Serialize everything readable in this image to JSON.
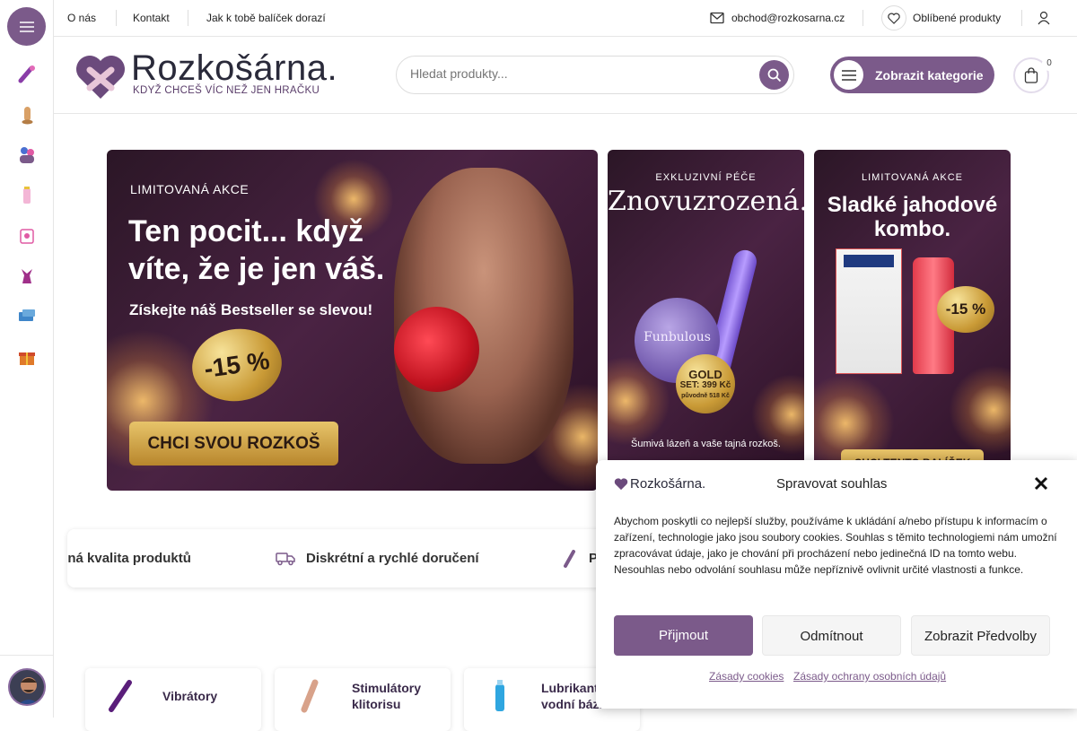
{
  "topbar": {
    "links": [
      "O nás",
      "Kontakt",
      "Jak k tobě balíček dorazí"
    ],
    "email": "obchod@rozkosarna.cz",
    "favorites": "Oblíbené produkty"
  },
  "header": {
    "brand": "Rozkošárna.",
    "tagline": "KDYŽ CHCEŠ VÍC NEŽ JEN HRAČKU",
    "search_placeholder": "Hledat produkty...",
    "categories_button": "Zobrazit kategorie",
    "cart_count": "0"
  },
  "sidebar": {
    "icons": [
      "vibrator-icon",
      "dildo-icon",
      "couples-icon",
      "lubricant-icon",
      "condom-icon",
      "lingerie-icon",
      "bdsm-icon",
      "gift-icon"
    ]
  },
  "banners": {
    "main": {
      "kicker": "LIMITOVANÁ AKCE",
      "headline": "Ten pocit... když víte, že je jen váš.",
      "subline": "Získejte náš Bestseller se slevou!",
      "badge": "-15 %",
      "cta": "CHCI SVOU ROZKOŠ"
    },
    "second": {
      "kicker": "EXKLUZIVNÍ PÉČE",
      "headline": "Znovuzrozená.",
      "product": "Funbulous",
      "badge_title": "GOLD",
      "badge_price": "SET: 399 Kč",
      "badge_note": "původně 518 Kč",
      "footer": "Šumivá lázeň a vaše tajná rozkoš."
    },
    "third": {
      "kicker": "LIMITOVANÁ AKCE",
      "headline": "Sladké jahodové kombo.",
      "badge": "-15 %",
      "cta": "CHCI TENTO BALÍČEK"
    }
  },
  "usp": [
    "ená kvalita produktů",
    "Diskrétní a rychlé doručení",
    "P"
  ],
  "categories": [
    "Vibrátory",
    "Stimulátory klitorisu",
    "Lubrikanty na vodní bázi"
  ],
  "cookie": {
    "brand": "Rozkošárna.",
    "title": "Spravovat souhlas",
    "body": "Abychom poskytli co nejlepší služby, používáme k ukládání a/nebo přístupu k informacím o zařízení, technologie jako jsou soubory cookies. Souhlas s těmito technologiemi nám umožní zpracovávat údaje, jako je chování při procházení nebo jedinečná ID na tomto webu. Nesouhlas nebo odvolání souhlasu může nepříznivě ovlivnit určité vlastnosti a funkce.",
    "accept": "Přijmout",
    "deny": "Odmítnout",
    "prefs": "Zobrazit Předvolby",
    "link_cookies": "Zásady cookies",
    "link_privacy": "Zásady ochrany osobních údajů"
  },
  "colors": {
    "accent": "#7b5a8a"
  }
}
